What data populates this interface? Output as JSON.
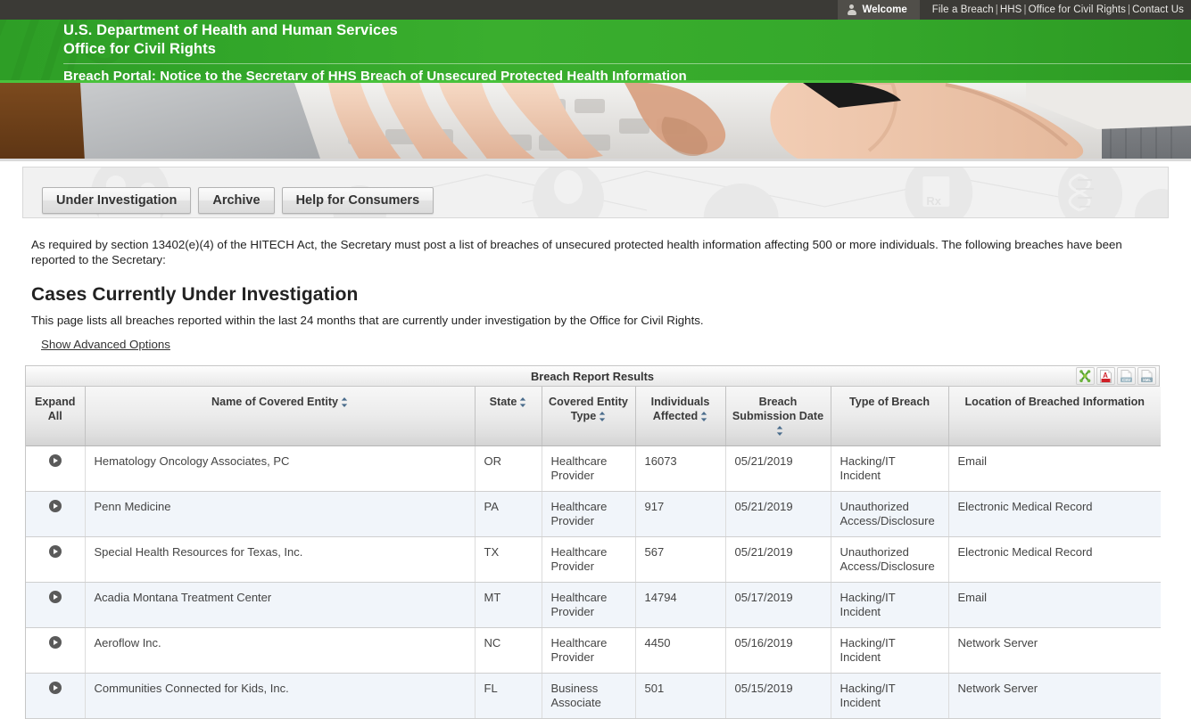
{
  "topnav": {
    "welcome_label": "Welcome",
    "welcome_icon": "person-icon",
    "links": [
      "File a Breach",
      "HHS",
      "Office for Civil Rights",
      "Contact Us"
    ],
    "separator": "|"
  },
  "header": {
    "line1": "U.S. Department of Health and Human Services",
    "line2": "Office for Civil Rights",
    "line3": "Breach Portal: Notice to the Secretary of HHS Breach of Unsecured Protected Health Information",
    "bg_color": "#35a82b"
  },
  "tabs": [
    {
      "label": "Under Investigation",
      "name": "tab-under-investigation"
    },
    {
      "label": "Archive",
      "name": "tab-archive"
    },
    {
      "label": "Help for Consumers",
      "name": "tab-help-for-consumers"
    }
  ],
  "intro_paragraph": "As required by section 13402(e)(4) of the HITECH Act, the Secretary must post a list of breaches of unsecured protected health information affecting 500 or more individuals. The following breaches have been reported to the Secretary:",
  "page_title": "Cases Currently Under Investigation",
  "page_subtitle": "This page lists all breaches reported within the last 24 months that are currently under investigation by the Office for Civil Rights.",
  "advanced_options_link": "Show Advanced Options",
  "results_panel": {
    "title": "Breach Report Results",
    "export_icons": [
      {
        "name": "xsl-export-icon",
        "label": "XSL"
      },
      {
        "name": "pdf-export-icon",
        "label": "PDF"
      },
      {
        "name": "csv-export-icon",
        "label": "CSV"
      },
      {
        "name": "xml-export-icon",
        "label": "XML"
      }
    ]
  },
  "table": {
    "columns": [
      {
        "label": "Expand All",
        "sortable": false,
        "key": "expand"
      },
      {
        "label": "Name of Covered Entity",
        "sortable": true,
        "key": "name"
      },
      {
        "label": "State",
        "sortable": true,
        "key": "state"
      },
      {
        "label": "Covered Entity Type",
        "sortable": true,
        "key": "entity_type"
      },
      {
        "label": "Individuals Affected",
        "sortable": true,
        "key": "individuals"
      },
      {
        "label": "Breach Submission Date",
        "sortable": true,
        "key": "date"
      },
      {
        "label": "Type of Breach",
        "sortable": false,
        "key": "breach_type"
      },
      {
        "label": "Location of Breached Information",
        "sortable": false,
        "key": "location"
      }
    ],
    "rows": [
      {
        "name": "Hematology Oncology Associates, PC",
        "state": "OR",
        "entity_type": "Healthcare Provider",
        "individuals": "16073",
        "date": "05/21/2019",
        "breach_type": "Hacking/IT Incident",
        "location": "Email"
      },
      {
        "name": "Penn Medicine",
        "state": "PA",
        "entity_type": "Healthcare Provider",
        "individuals": "917",
        "date": "05/21/2019",
        "breach_type": "Unauthorized Access/Disclosure",
        "location": "Electronic Medical Record"
      },
      {
        "name": "Special Health Resources for Texas, Inc.",
        "state": "TX",
        "entity_type": "Healthcare Provider",
        "individuals": "567",
        "date": "05/21/2019",
        "breach_type": "Unauthorized Access/Disclosure",
        "location": "Electronic Medical Record"
      },
      {
        "name": "Acadia Montana Treatment Center",
        "state": "MT",
        "entity_type": "Healthcare Provider",
        "individuals": "14794",
        "date": "05/17/2019",
        "breach_type": "Hacking/IT Incident",
        "location": "Email"
      },
      {
        "name": "Aeroflow Inc.",
        "state": "NC",
        "entity_type": "Healthcare Provider",
        "individuals": "4450",
        "date": "05/16/2019",
        "breach_type": "Hacking/IT Incident",
        "location": "Network Server"
      },
      {
        "name": "Communities Connected for Kids, Inc.",
        "state": "FL",
        "entity_type": "Business Associate",
        "individuals": "501",
        "date": "05/15/2019",
        "breach_type": "Hacking/IT Incident",
        "location": "Network Server"
      }
    ]
  }
}
